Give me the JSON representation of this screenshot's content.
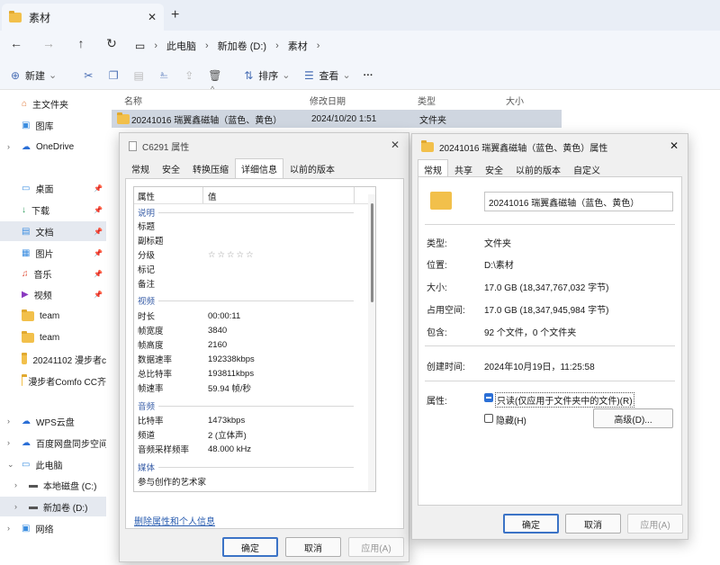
{
  "window": {
    "tab_title": "素材"
  },
  "breadcrumb": [
    "此电脑",
    "新加卷 (D:)",
    "素材"
  ],
  "toolbar": {
    "new": "新建",
    "sort": "排序",
    "view": "查看",
    "more": "···"
  },
  "sidebar": {
    "items": [
      {
        "label": "主文件夹"
      },
      {
        "label": "图库"
      },
      {
        "label": "OneDrive"
      },
      {
        "label": "桌面"
      },
      {
        "label": "下载"
      },
      {
        "label": "文档"
      },
      {
        "label": "图片"
      },
      {
        "label": "音乐"
      },
      {
        "label": "视频"
      },
      {
        "label": "team"
      },
      {
        "label": "team"
      },
      {
        "label": "20241102 漫步者c"
      },
      {
        "label": "漫步者Comfo CC齐"
      },
      {
        "label": "WPS云盘"
      },
      {
        "label": "百度网盘同步空间"
      },
      {
        "label": "此电脑"
      },
      {
        "label": "本地磁盘 (C:)"
      },
      {
        "label": "新加卷 (D:)"
      },
      {
        "label": "网络"
      }
    ]
  },
  "file_list": {
    "columns": [
      "名称",
      "修改日期",
      "类型",
      "大小"
    ],
    "rows": [
      {
        "name": "20241016 瑞翼鑫磁轴（蓝色、黄色）",
        "date": "2024/10/20 1:51",
        "type": "文件夹",
        "size": ""
      }
    ]
  },
  "dialog_left": {
    "title": "C6291 属性",
    "tabs": [
      "常规",
      "安全",
      "转换压缩",
      "详细信息",
      "以前的版本"
    ],
    "header": {
      "prop": "属性",
      "val": "值"
    },
    "sections": [
      {
        "name": "说明",
        "rows": [
          [
            "标题",
            ""
          ],
          [
            "副标题",
            ""
          ],
          [
            "分级",
            "☆☆☆☆☆"
          ],
          [
            "标记",
            ""
          ],
          [
            "备注",
            ""
          ]
        ]
      },
      {
        "name": "视频",
        "rows": [
          [
            "时长",
            "00:00:11"
          ],
          [
            "帧宽度",
            "3840"
          ],
          [
            "帧高度",
            "2160"
          ],
          [
            "数据速率",
            "192338kbps"
          ],
          [
            "总比特率",
            "193811kbps"
          ],
          [
            "帧速率",
            "59.94 帧/秒"
          ]
        ]
      },
      {
        "name": "音频",
        "rows": [
          [
            "比特率",
            "1473kbps"
          ],
          [
            "频道",
            "2 (立体声)"
          ],
          [
            "音频采样频率",
            "48.000 kHz"
          ]
        ]
      },
      {
        "name": "媒体",
        "rows": [
          [
            "参与创作的艺术家",
            ""
          ]
        ]
      }
    ],
    "link": "删除属性和个人信息",
    "ok": "确定",
    "cancel": "取消",
    "apply": "应用(A)"
  },
  "dialog_right": {
    "title": "20241016 瑞翼鑫磁轴（蓝色、黄色）属性",
    "tabs": [
      "常规",
      "共享",
      "安全",
      "以前的版本",
      "自定义"
    ],
    "folder_name": "20241016 瑞翼鑫磁轴（蓝色、黄色）",
    "fields": [
      {
        "label": "类型:",
        "value": "文件夹"
      },
      {
        "label": "位置:",
        "value": "D:\\素材"
      },
      {
        "label": "大小:",
        "value": "17.0 GB (18,347,767,032 字节)"
      },
      {
        "label": "占用空间:",
        "value": "17.0 GB (18,347,945,984 字节)"
      },
      {
        "label": "包含:",
        "value": "92 个文件，0 个文件夹"
      },
      {
        "label": "创建时间:",
        "value": "2024年10月19日，11:25:58"
      }
    ],
    "attr_label": "属性:",
    "readonly": "只读(仅应用于文件夹中的文件)(R)",
    "hidden": "隐藏(H)",
    "advanced": "高级(D)...",
    "ok": "确定",
    "cancel": "取消",
    "apply": "应用(A)"
  }
}
